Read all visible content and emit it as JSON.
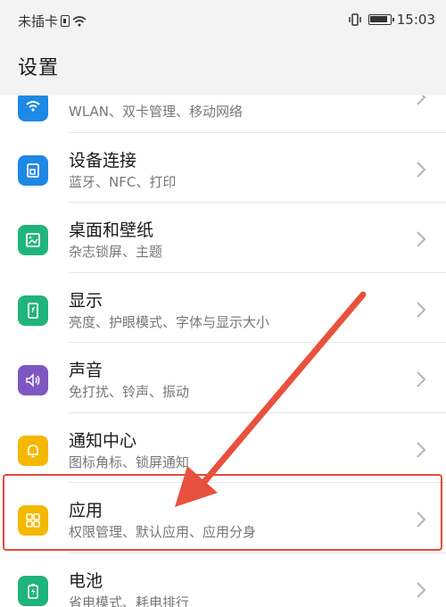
{
  "status_bar": {
    "carrier": "未插卡",
    "time": "15:03"
  },
  "header": {
    "title": "设置"
  },
  "settings_items": [
    {
      "title": "",
      "subtitle": "WLAN、双卡管理、移动网络",
      "icon": "wifi-icon",
      "color": "#1e88e5"
    },
    {
      "title": "设备连接",
      "subtitle": "蓝牙、NFC、打印",
      "icon": "device-connection-icon",
      "color": "#1e88e5"
    },
    {
      "title": "桌面和壁纸",
      "subtitle": "杂志锁屏、主题",
      "icon": "wallpaper-icon",
      "color": "#1fb57a"
    },
    {
      "title": "显示",
      "subtitle": "亮度、护眼模式、字体与显示大小",
      "icon": "display-icon",
      "color": "#1fb57a"
    },
    {
      "title": "声音",
      "subtitle": "免打扰、铃声、振动",
      "icon": "sound-icon",
      "color": "#7e57c2"
    },
    {
      "title": "通知中心",
      "subtitle": "图标角标、锁屏通知",
      "icon": "notification-bell-icon",
      "color": "#f5b800"
    },
    {
      "title": "应用",
      "subtitle": "权限管理、默认应用、应用分身",
      "icon": "apps-grid-icon",
      "color": "#f5b800"
    },
    {
      "title": "电池",
      "subtitle": "省电模式、耗电排行",
      "icon": "battery-icon",
      "color": "#1fb57a"
    }
  ],
  "annotation": {
    "highlight_color": "#e04a3b"
  }
}
